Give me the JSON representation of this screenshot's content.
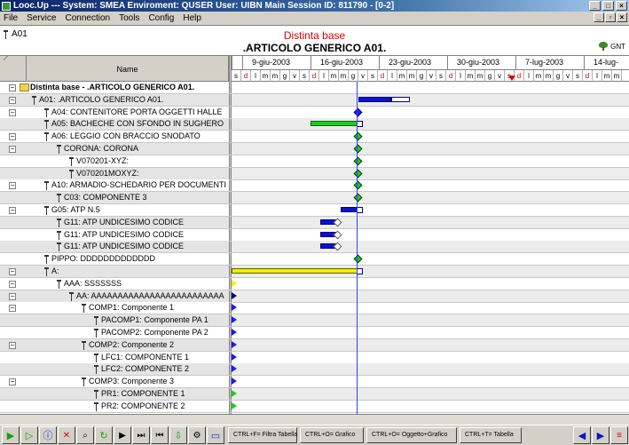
{
  "window": {
    "title": "Looc.Up  ---  System: SMEA Enviroment: QUSER User: UIBN Main Session ID: 811790 - [0-2]"
  },
  "menu": [
    "File",
    "Service",
    "Connection",
    "Tools",
    "Config",
    "Help"
  ],
  "header": {
    "code": "A01",
    "title": "Distinta base",
    "subtitle": ".ARTICOLO GENERICO A01.",
    "gnt_label": "GNT"
  },
  "grid": {
    "name_header": "Name",
    "weeks": [
      "9-giu-2003",
      "16-giu-2003",
      "23-giu-2003",
      "30-giu-2003",
      "7-lug-2003",
      "14-lug-"
    ],
    "days": [
      "s",
      "d",
      "l",
      "m",
      "m",
      "g",
      "v",
      "s",
      "d",
      "l",
      "m",
      "m",
      "g",
      "v",
      "s",
      "d",
      "l",
      "m",
      "m",
      "g",
      "v",
      "s",
      "d",
      "l",
      "m",
      "m",
      "g",
      "v",
      "s",
      "d",
      "l",
      "m",
      "m",
      "g",
      "v",
      "s",
      "d",
      "l",
      "m",
      "m"
    ],
    "rows": [
      {
        "label": "Distinta base - .ARTICOLO GENERICO A01."
      },
      {
        "label": "A01: .ARTICOLO GENERICO A01."
      },
      {
        "label": "A04: CONTENITORE PORTA OGGETTI HALLE"
      },
      {
        "label": "A05: BACHECHE CON SFONDO IN SUGHERO"
      },
      {
        "label": "A06: LEGGIO CON BRACCIO SNODATO"
      },
      {
        "label": "CORONA: CORONA"
      },
      {
        "label": "V070201-XYZ:"
      },
      {
        "label": "V070201MOXYZ:"
      },
      {
        "label": "A10: ARMADIO-SCHEDARIO PER DOCUMENTI"
      },
      {
        "label": "C03: COMPONENTE 3"
      },
      {
        "label": "G05: ATP N.5"
      },
      {
        "label": "G11: ATP UNDICESIMO CODICE"
      },
      {
        "label": "G11: ATP UNDICESIMO CODICE"
      },
      {
        "label": "G11: ATP UNDICESIMO CODICE"
      },
      {
        "label": "PIPPO: DDDDDDDDDDDDD"
      },
      {
        "label": "A:"
      },
      {
        "label": "AAA: SSSSSSS"
      },
      {
        "label": "AA: AAAAAAAAAAAAAAAAAAAAAAAAA"
      },
      {
        "label": "COMP1: Componente 1"
      },
      {
        "label": "PACOMP1: Componente PA 1"
      },
      {
        "label": "PACOMP2: Componente PA 2"
      },
      {
        "label": "COMP2: Componente 2"
      },
      {
        "label": "LFC1: COMPONENTE 1"
      },
      {
        "label": "LFC2: COMPONENTE 2"
      },
      {
        "label": "COMP3: Componente 3"
      },
      {
        "label": "PR1: COMPONENTE 1"
      },
      {
        "label": "PR2: COMPONENTE 2"
      }
    ]
  },
  "toolbar": {
    "btn1": "CTRL+F= Filtra Tabella",
    "btn2": "CTRL+O= Grafico",
    "btn3": "CTRL+O= Oggetto+Grafico",
    "btn4": "CTRL+T= Tabella"
  },
  "colors": {
    "title_red": "#e00000",
    "bar_blue": "#0a14c8",
    "bar_green": "#22c822",
    "bar_yellow": "#f0f000",
    "today_line": "#3040ff"
  }
}
